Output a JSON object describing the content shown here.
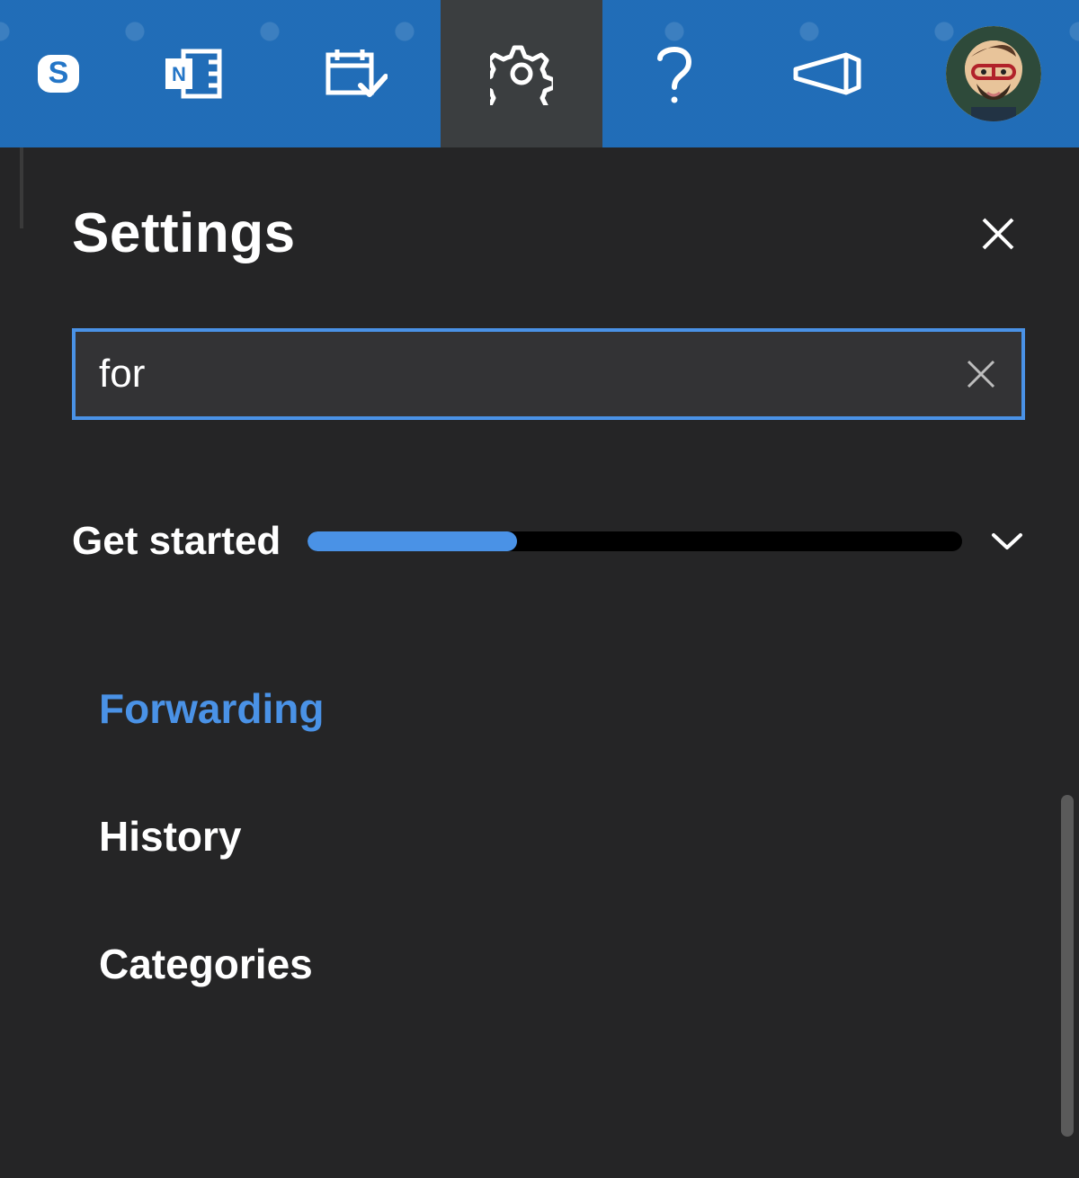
{
  "topbar": {
    "items": [
      {
        "name": "skype-icon"
      },
      {
        "name": "onenote-icon"
      },
      {
        "name": "calendar-check-icon"
      },
      {
        "name": "gear-icon",
        "active": true
      },
      {
        "name": "help-icon"
      },
      {
        "name": "megaphone-icon"
      }
    ]
  },
  "panel": {
    "title": "Settings",
    "search": {
      "value": "for"
    },
    "get_started": {
      "label": "Get started",
      "progress_pct": 32
    },
    "results": [
      {
        "label": "Forwarding",
        "highlight": true
      },
      {
        "label": "History",
        "highlight": false
      },
      {
        "label": "Categories",
        "highlight": false
      }
    ]
  },
  "colors": {
    "accent": "#4a92e6",
    "panel_bg": "#252526",
    "topbar_blue": "#2476c7"
  }
}
